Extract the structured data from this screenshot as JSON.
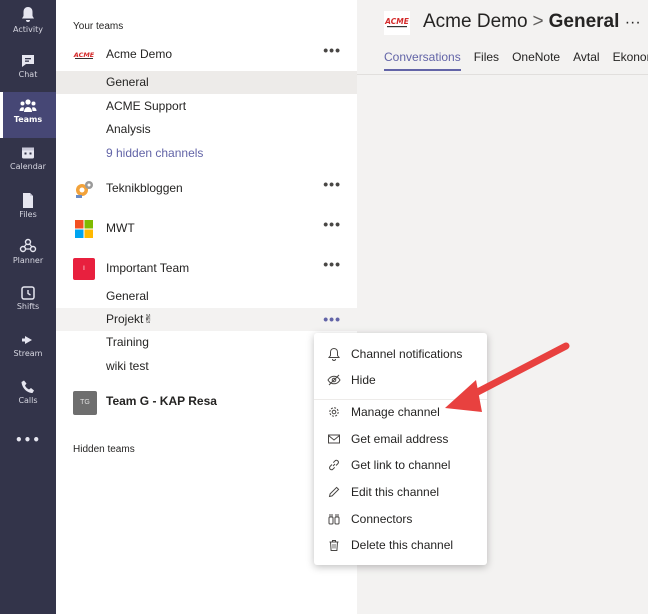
{
  "rail": [
    {
      "label": "Activity",
      "icon": "bell-icon"
    },
    {
      "label": "Chat",
      "icon": "chat-icon"
    },
    {
      "label": "Teams",
      "icon": "teams-icon",
      "active": true
    },
    {
      "label": "Calendar",
      "icon": "calendar-icon"
    },
    {
      "label": "Files",
      "icon": "files-icon"
    },
    {
      "label": "Planner",
      "icon": "planner-icon"
    },
    {
      "label": "Shifts",
      "icon": "shifts-icon"
    },
    {
      "label": "Stream",
      "icon": "stream-icon"
    },
    {
      "label": "Calls",
      "icon": "calls-icon"
    },
    {
      "label": "•••",
      "icon": "more-apps-icon"
    }
  ],
  "teams_panel": {
    "your_teams_title": "Your teams",
    "hidden_teams_title": "Hidden teams",
    "more_glyph": "•••",
    "teams": [
      {
        "name": "Acme Demo",
        "channels": [
          "General",
          "ACME Support",
          "Analysis",
          "9 hidden channels"
        ]
      },
      {
        "name": "Teknikbloggen",
        "channels": []
      },
      {
        "name": "MWT",
        "channels": []
      },
      {
        "name": "Important Team",
        "avatar_letter": "I",
        "channels": [
          "General",
          "Projekt✌",
          "Training",
          "wiki test"
        ]
      },
      {
        "name": "Team G - KAP Resa",
        "avatar_letter": "TG",
        "channels": []
      }
    ]
  },
  "header": {
    "team": "Acme Demo",
    "separator": ">",
    "channel": "General",
    "more": "···",
    "logo_text": "ACME",
    "tabs": [
      "Conversations",
      "Files",
      "OneNote",
      "Avtal",
      "Ekonomi"
    ]
  },
  "context_menu": {
    "items": [
      {
        "label": "Channel notifications",
        "icon": "bell-icon"
      },
      {
        "label": "Hide",
        "icon": "hide-icon"
      },
      {
        "label": "Manage channel",
        "icon": "gear-icon"
      },
      {
        "label": "Get email address",
        "icon": "mail-icon"
      },
      {
        "label": "Get link to channel",
        "icon": "link-icon"
      },
      {
        "label": "Edit this channel",
        "icon": "pencil-icon"
      },
      {
        "label": "Connectors",
        "icon": "connectors-icon"
      },
      {
        "label": "Delete this channel",
        "icon": "trash-icon"
      }
    ]
  },
  "colors": {
    "rail_bg": "#33344a",
    "accent": "#6264a7",
    "annotation_arrow": "#e8413f"
  }
}
